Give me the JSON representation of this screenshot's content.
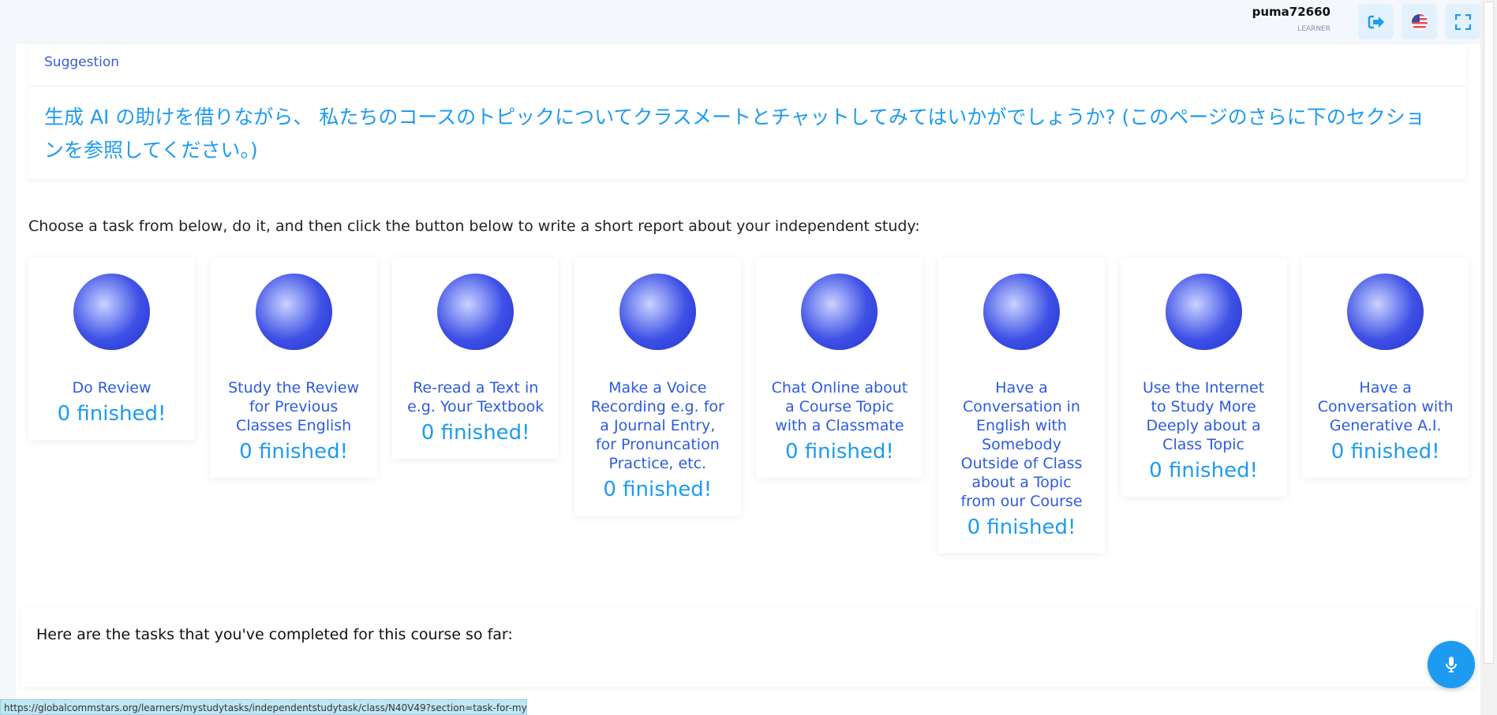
{
  "header": {
    "username": "puma72660",
    "role": "LEARNER",
    "icons": [
      "logout-icon",
      "us-flag-icon",
      "fullscreen-icon"
    ]
  },
  "suggestion": {
    "title": "Suggestion",
    "text": "生成 AI の助けを借りながら、 私たちのコースのトピックについてクラスメートとチャットしてみてはいかがでしょうか? (このページのさらに下のセクションを参照してください。)"
  },
  "instruction": "Choose a task from below, do it, and then click the button below to write a short report about your independent study:",
  "tasks": [
    {
      "label": "Do Review",
      "status": "0 finished!"
    },
    {
      "label": "Study the Review for Previous Classes English",
      "status": "0 finished!"
    },
    {
      "label": "Re-read a Text in e.g. Your Textbook",
      "status": "0 finished!"
    },
    {
      "label": "Make a Voice Recording e.g. for a Journal Entry, for Pronuncation Practice, etc.",
      "status": "0 finished!"
    },
    {
      "label": "Chat Online about a Course Topic with a Classmate",
      "status": "0 finished!"
    },
    {
      "label": "Have a Conversation in English with Somebody Outside of Class about a Topic from our Course",
      "status": "0 finished!"
    },
    {
      "label": "Use the Internet to Study More Deeply about a Class Topic",
      "status": "0 finished!"
    },
    {
      "label": "Have a Conversation with Generative A.I.",
      "status": "0 finished!"
    }
  ],
  "completed": {
    "title": "Here are the tasks that you've completed for this course so far:"
  },
  "status_url": "https://globalcommstars.org/learners/mystudytasks/independentstudytask/class/N40V49?section=task-for-my-teacher...",
  "colors": {
    "accent": "#1d9bf0",
    "title": "#2c5be0"
  }
}
